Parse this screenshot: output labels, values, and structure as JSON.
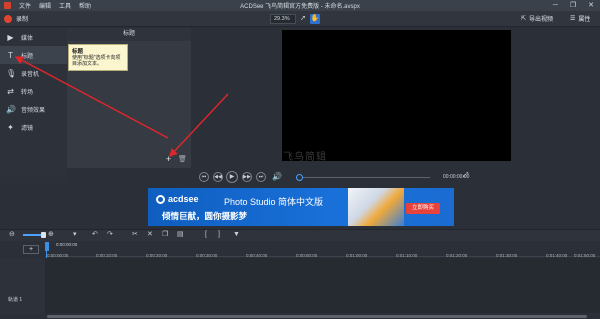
{
  "menu": {
    "items": [
      "文件",
      "编辑",
      "工具",
      "帮助"
    ],
    "window_title": "ACDSee 飞鸟简辑官方免费版 - 未命名.avspx",
    "minimize": "─",
    "restore": "❐",
    "close": "✕"
  },
  "toolbar": {
    "record_label": "录制",
    "zoom_value": "29.3%",
    "export_label": "导出视频",
    "properties_label": "属性"
  },
  "sidebar": {
    "items": [
      {
        "label": "媒体",
        "icon": "media-icon"
      },
      {
        "label": "标题",
        "icon": "text-icon"
      },
      {
        "label": "录音机",
        "icon": "microphone-icon"
      },
      {
        "label": "转场",
        "icon": "transition-icon"
      },
      {
        "label": "音频效果",
        "icon": "audio-effect-icon"
      },
      {
        "label": "滤镜",
        "icon": "filter-wand-icon"
      }
    ]
  },
  "panel": {
    "header": "标题",
    "tooltip_title": "标题",
    "tooltip_text": "使用\"标题\"选项卡向项目添加文本。"
  },
  "preview": {
    "watermark": "飞鸟简辑"
  },
  "transport": {
    "time": "00:00:00:00"
  },
  "banner": {
    "brand": "acdsee",
    "product": "Photo Studio 简体中文版",
    "slogan": "倾情巨献，圆你摄影梦",
    "cta": "立即购买"
  },
  "timeline": {
    "current_time": "0:00:00:00",
    "ticks": [
      "0:00:00:00",
      "0:00:10:00",
      "0:00:20:00",
      "0:00:30:00",
      "0:00:40:00",
      "0:00:50:00",
      "0:01:00:00",
      "0:01:10:00",
      "0:01:20:00",
      "0:01:30:00",
      "0:01:40:00",
      "0:01:50:00"
    ],
    "track_name": "轨道 1",
    "add_track": "+"
  },
  "colors": {
    "accent": "#2e6fd0",
    "annotation_arrow": "#e0262b",
    "record": "#e0452f",
    "banner_cta": "#e8423c"
  }
}
